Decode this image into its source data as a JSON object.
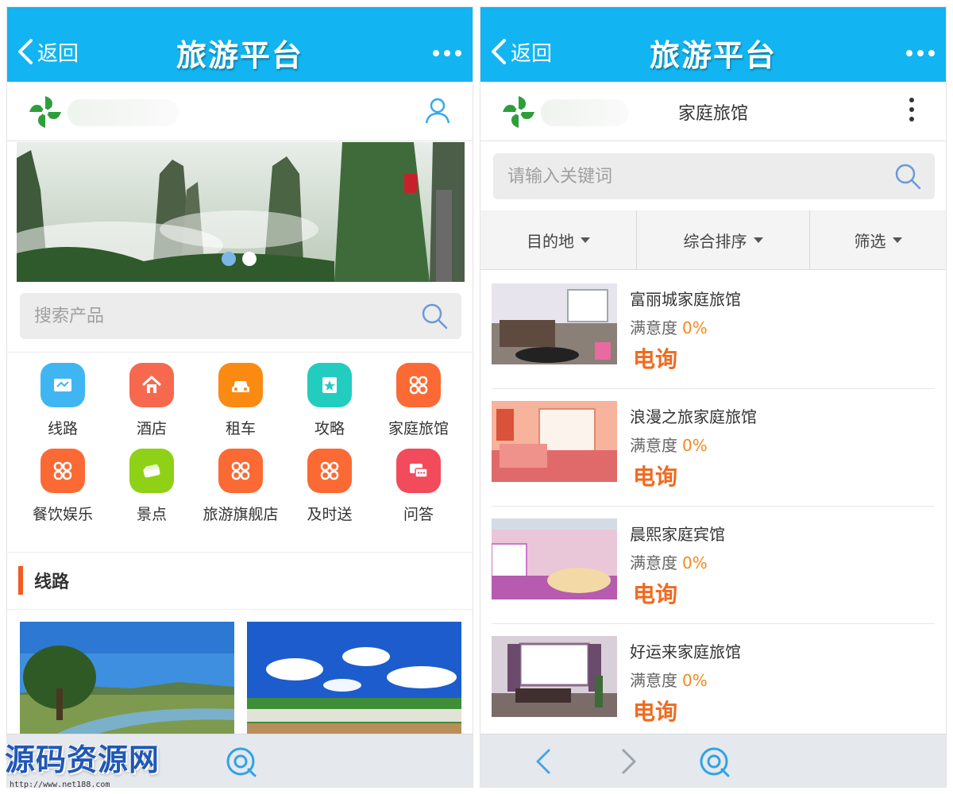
{
  "colors": {
    "topbar": "#12b5f1",
    "accent_orange": "#f06a1f",
    "satisfaction_orange": "#f28a1f",
    "section_bar": "#f25a22",
    "watermark_blue": "#1f57b5"
  },
  "left": {
    "topbar": {
      "back_label": "返回",
      "title": "旅游平台",
      "more_icon": "more-dots-icon"
    },
    "header": {
      "logo_icon": "pinwheel-logo-icon",
      "user_icon": "user-icon"
    },
    "banner": {
      "dots_count": 2,
      "active_dot": 1
    },
    "search": {
      "placeholder": "搜索产品",
      "icon": "search-icon"
    },
    "categories": [
      {
        "label": "线路",
        "icon": "map-icon",
        "color": "#3fb6f2"
      },
      {
        "label": "酒店",
        "icon": "home-icon",
        "color": "#f7694e"
      },
      {
        "label": "租车",
        "icon": "car-icon",
        "color": "#fb8a12"
      },
      {
        "label": "攻略",
        "icon": "guide-icon",
        "color": "#22cdbf"
      },
      {
        "label": "家庭旅馆",
        "icon": "clover-icon",
        "color": "#fb6a34"
      },
      {
        "label": "餐饮娱乐",
        "icon": "clover-icon",
        "color": "#fb6a34"
      },
      {
        "label": "景点",
        "icon": "ticket-icon",
        "color": "#8fd116"
      },
      {
        "label": "旅游旗舰店",
        "icon": "clover-icon",
        "color": "#fb6a34"
      },
      {
        "label": "及时送",
        "icon": "clover-icon",
        "color": "#fb6a34"
      },
      {
        "label": "问答",
        "icon": "chat-icon",
        "color": "#f24b5c"
      }
    ],
    "section": {
      "title": "线路"
    },
    "bottombar": {
      "center_icon": "browser-icon"
    }
  },
  "right": {
    "topbar": {
      "back_label": "返回",
      "title": "旅游平台",
      "more_icon": "more-dots-icon"
    },
    "header": {
      "title": "家庭旅馆",
      "logo_icon": "pinwheel-logo-icon",
      "menu_icon": "kebab-icon"
    },
    "search": {
      "placeholder": "请输入关键词",
      "icon": "search-icon"
    },
    "filters": [
      {
        "label": "目的地"
      },
      {
        "label": "综合排序"
      },
      {
        "label": "筛选"
      }
    ],
    "listings": [
      {
        "name": "富丽城家庭旅馆",
        "satisfaction_label": "满意度",
        "satisfaction": "0%",
        "price": "电询"
      },
      {
        "name": "浪漫之旅家庭旅馆",
        "satisfaction_label": "满意度",
        "satisfaction": "0%",
        "price": "电询"
      },
      {
        "name": "晨熙家庭宾馆",
        "satisfaction_label": "满意度",
        "satisfaction": "0%",
        "price": "电询"
      },
      {
        "name": "好运来家庭旅馆",
        "satisfaction_label": "满意度",
        "satisfaction": "0%",
        "price": "电询"
      }
    ],
    "bottombar": {
      "back_icon": "chevron-left-icon",
      "forward_icon": "chevron-right-icon",
      "center_icon": "browser-icon"
    }
  },
  "watermark": {
    "text": "源码资源网",
    "url": "http://www.net188.com"
  }
}
